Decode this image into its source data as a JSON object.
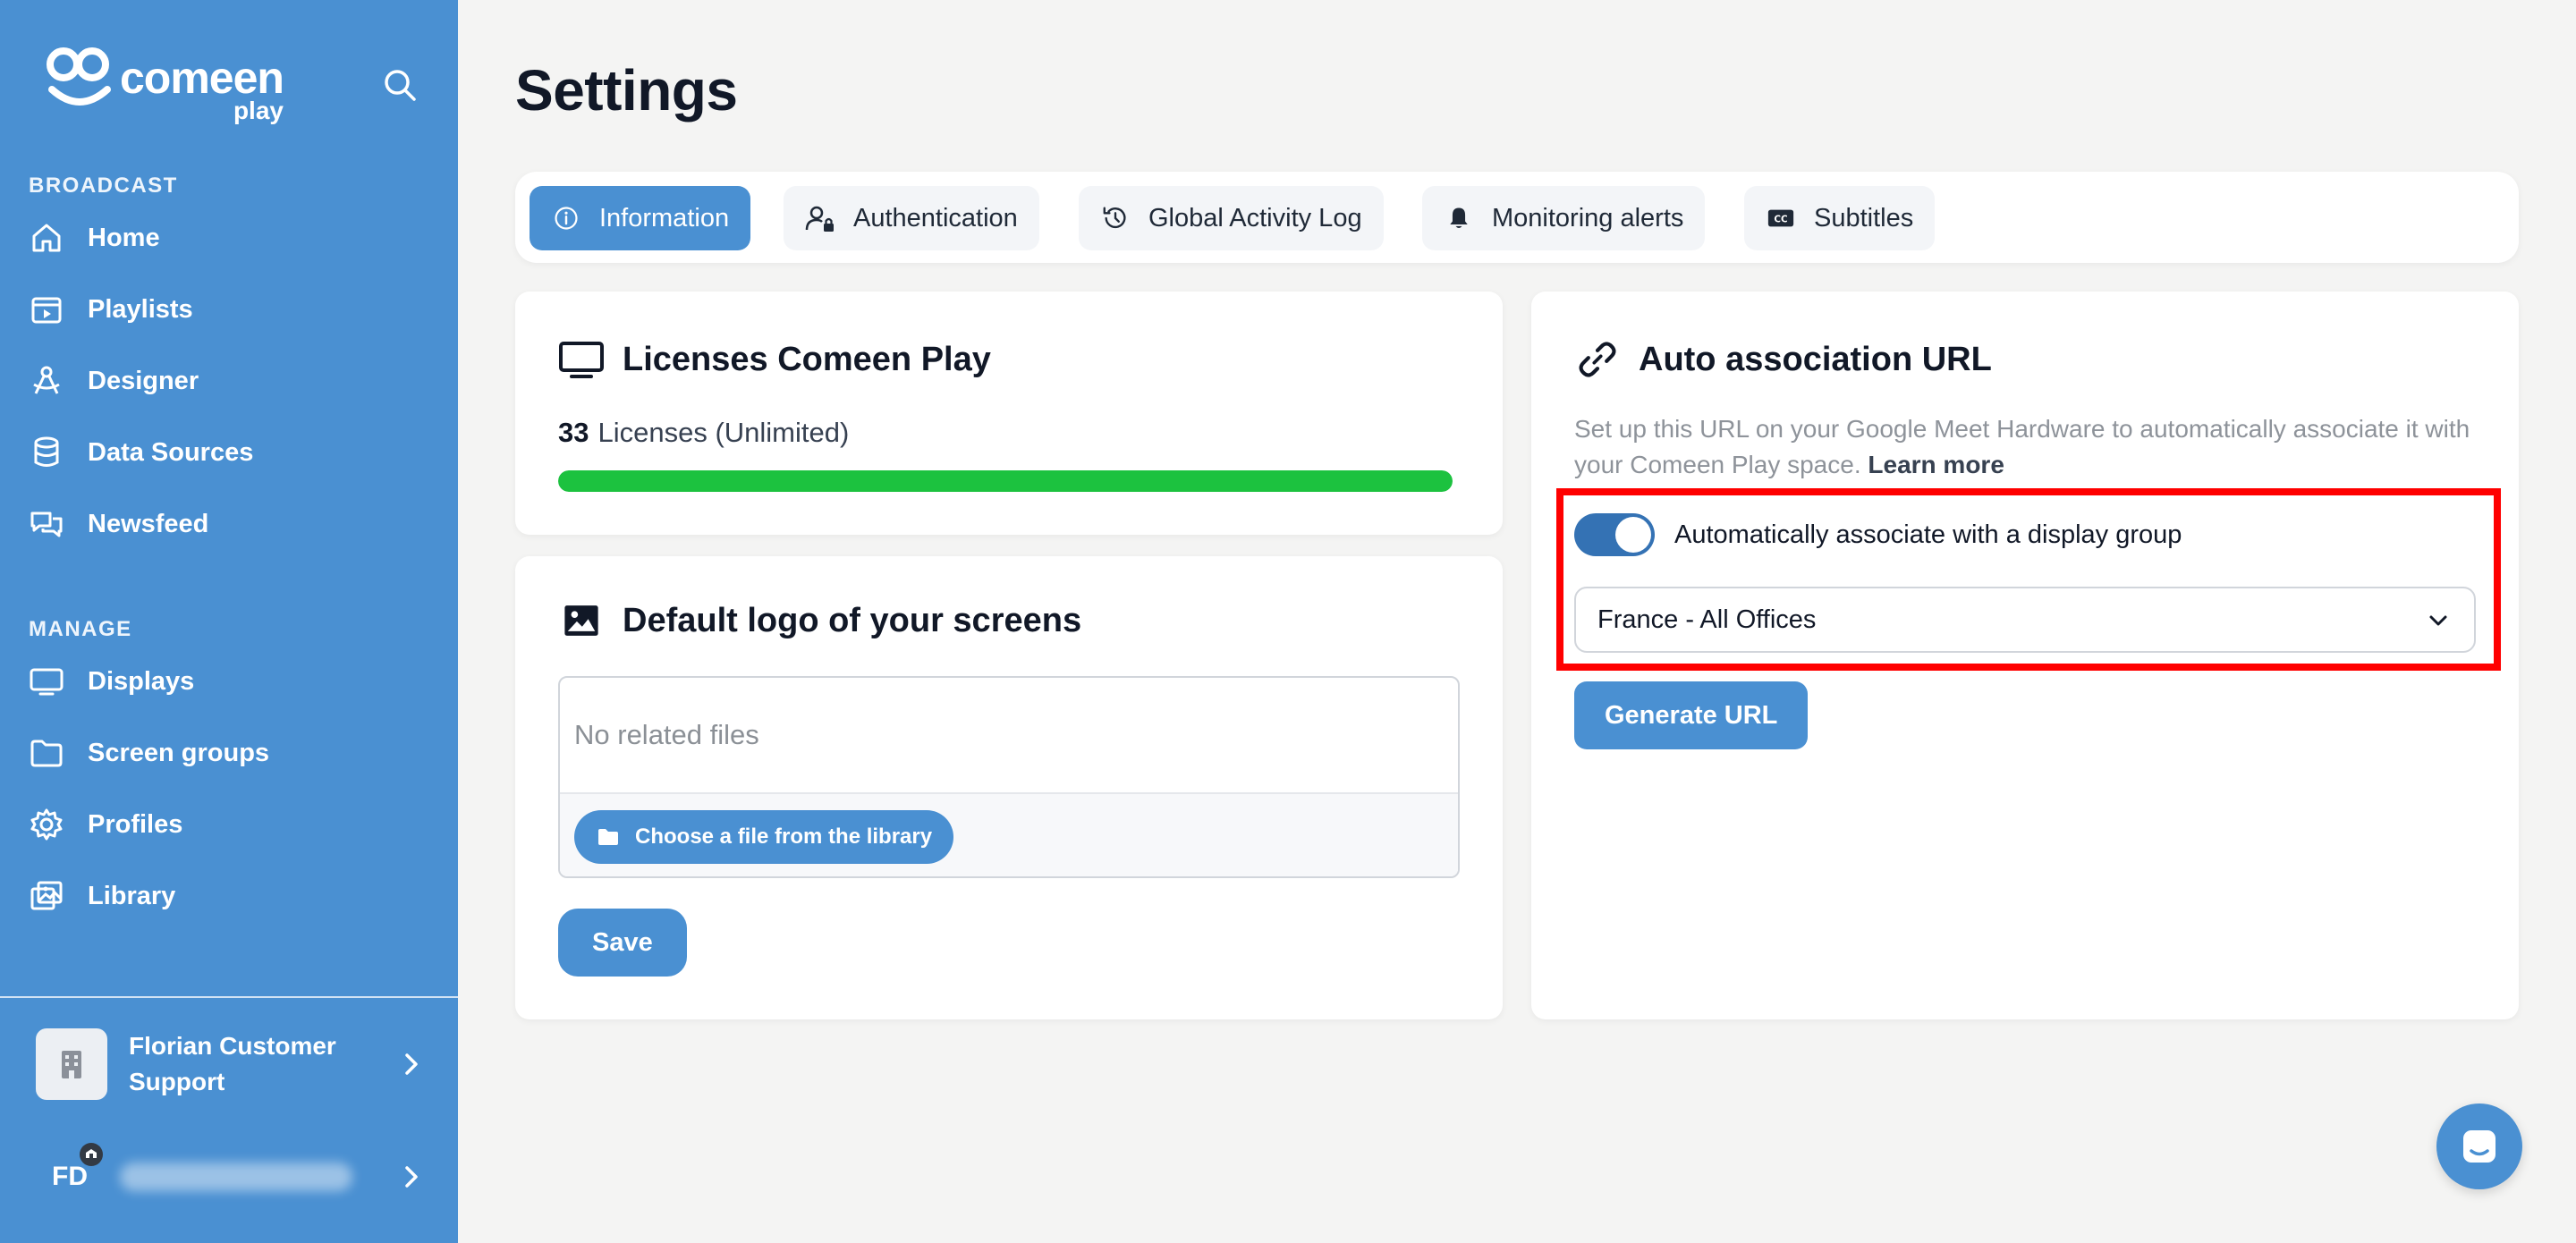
{
  "sidebar": {
    "logo": {
      "word": "comeen",
      "sub": "play"
    },
    "sections": {
      "broadcast": "BROADCAST",
      "manage": "MANAGE"
    },
    "broadcast_items": [
      {
        "label": "Home",
        "icon": "home-icon"
      },
      {
        "label": "Playlists",
        "icon": "playlist-icon"
      },
      {
        "label": "Designer",
        "icon": "designer-icon"
      },
      {
        "label": "Data Sources",
        "icon": "database-icon"
      },
      {
        "label": "Newsfeed",
        "icon": "chat-bubbles-icon"
      }
    ],
    "manage_items": [
      {
        "label": "Displays",
        "icon": "monitor-icon"
      },
      {
        "label": "Screen groups",
        "icon": "folder-icon"
      },
      {
        "label": "Profiles",
        "icon": "gear-icon"
      },
      {
        "label": "Library",
        "icon": "images-icon"
      }
    ],
    "account": {
      "name": "Florian Customer Support"
    },
    "user": {
      "initials": "FD"
    }
  },
  "page": {
    "title": "Settings"
  },
  "tabs": [
    {
      "label": "Information",
      "active": true,
      "icon": "info-icon"
    },
    {
      "label": "Authentication",
      "active": false,
      "icon": "user-lock-icon"
    },
    {
      "label": "Global Activity Log",
      "active": false,
      "icon": "history-icon"
    },
    {
      "label": "Monitoring alerts",
      "active": false,
      "icon": "bell-icon"
    },
    {
      "label": "Subtitles",
      "active": false,
      "icon": "closed-captions-icon"
    }
  ],
  "licenses": {
    "title": "Licenses Comeen Play",
    "count": "33",
    "count_label": "Licenses (Unlimited)",
    "progress": 1.0,
    "progress_color": "#1cc23f"
  },
  "default_logo": {
    "title": "Default logo of your screens",
    "empty_text": "No related files",
    "choose_label": "Choose a file from the library",
    "save_label": "Save"
  },
  "auto_association": {
    "title": "Auto association URL",
    "description": "Set up this URL on your Google Meet Hardware to automatically associate it with your Comeen Play space.",
    "learn_more": "Learn more",
    "toggle_label": "Automatically associate with a display group",
    "toggle_on": true,
    "selected_group": "France - All Offices",
    "generate_label": "Generate URL"
  },
  "colors": {
    "brand": "#4a90d2",
    "highlight": "#ff0000",
    "progress": "#1cc23f"
  }
}
